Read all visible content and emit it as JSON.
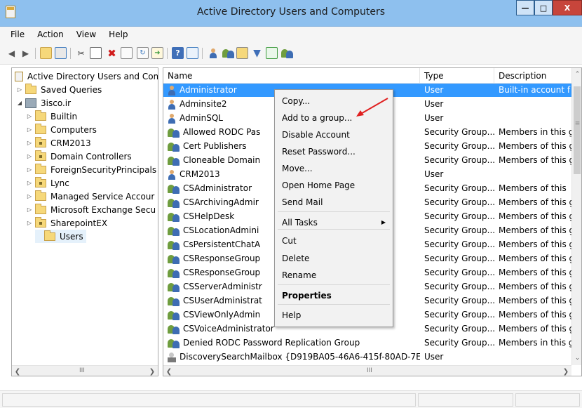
{
  "window": {
    "title": "Active Directory Users and Computers",
    "controls": {
      "minimize": "—",
      "maximize": "□",
      "close": "X"
    }
  },
  "menubar": [
    "File",
    "Action",
    "View",
    "Help"
  ],
  "toolbar_icons": [
    "back-arrow-icon",
    "forward-arrow-icon",
    "up-folder-icon",
    "show-console-tree-icon",
    "cut-icon",
    "copy-icon",
    "delete-icon",
    "properties-icon",
    "refresh-icon",
    "export-list-icon",
    "help-icon",
    "action-pane-icon",
    "new-user-icon",
    "new-group-icon",
    "new-ou-icon",
    "filter-icon",
    "find-icon",
    "add-to-group-icon"
  ],
  "tree": {
    "root": "Active Directory Users and Com",
    "items": [
      {
        "label": "Saved Queries",
        "level": 1,
        "expander": "▷",
        "icon": "folder"
      },
      {
        "label": "3isco.ir",
        "level": 1,
        "expander": "◢",
        "icon": "domain"
      },
      {
        "label": "Builtin",
        "level": 2,
        "expander": "▷",
        "icon": "folder"
      },
      {
        "label": "Computers",
        "level": 2,
        "expander": "▷",
        "icon": "folder"
      },
      {
        "label": "CRM2013",
        "level": 2,
        "expander": "▷",
        "icon": "ou"
      },
      {
        "label": "Domain Controllers",
        "level": 2,
        "expander": "▷",
        "icon": "ou"
      },
      {
        "label": "ForeignSecurityPrincipals",
        "level": 2,
        "expander": "▷",
        "icon": "folder"
      },
      {
        "label": "Lync",
        "level": 2,
        "expander": "▷",
        "icon": "ou"
      },
      {
        "label": "Managed Service Accour",
        "level": 2,
        "expander": "▷",
        "icon": "folder"
      },
      {
        "label": "Microsoft Exchange Secu",
        "level": 2,
        "expander": "▷",
        "icon": "folder"
      },
      {
        "label": "SharepointEX",
        "level": 2,
        "expander": "▷",
        "icon": "ou"
      },
      {
        "label": "Users",
        "level": 2,
        "expander": "",
        "icon": "folder",
        "selected": true
      }
    ],
    "scroll_grip": "III"
  },
  "list": {
    "columns": [
      "Name",
      "Type",
      "Description"
    ],
    "rows": [
      {
        "name": "Administrator",
        "type": "User",
        "desc": "Built-in account f",
        "icon": "user",
        "selected": true
      },
      {
        "name": "Adminsite2",
        "type": "User",
        "desc": "",
        "icon": "user"
      },
      {
        "name": "AdminSQL",
        "type": "User",
        "desc": "",
        "icon": "user"
      },
      {
        "name": "Allowed RODC Pas",
        "type": "Security Group...",
        "desc": "Members in this g",
        "icon": "group"
      },
      {
        "name": "Cert Publishers",
        "type": "Security Group...",
        "desc": "Members of this g",
        "icon": "group"
      },
      {
        "name": "Cloneable Domain",
        "type": "Security Group...",
        "desc": "Members of this g",
        "icon": "group"
      },
      {
        "name": "CRM2013",
        "type": "User",
        "desc": "",
        "icon": "user"
      },
      {
        "name": "CSAdministrator",
        "type": "Security Group...",
        "desc": "Members of this",
        "icon": "group"
      },
      {
        "name": "CSArchivingAdmir",
        "type": "Security Group...",
        "desc": "Members of this g",
        "icon": "group"
      },
      {
        "name": "CSHelpDesk",
        "type": "Security Group...",
        "desc": "Members of this g",
        "icon": "group"
      },
      {
        "name": "CSLocationAdmini",
        "type": "Security Group...",
        "desc": "Members of this g",
        "icon": "group"
      },
      {
        "name": "CsPersistentChatA",
        "type": "Security Group...",
        "desc": "Members of this g",
        "icon": "group"
      },
      {
        "name": "CSResponseGroup",
        "type": "Security Group...",
        "desc": "Members of this g",
        "icon": "group"
      },
      {
        "name": "CSResponseGroup",
        "type": "Security Group...",
        "desc": "Members of this g",
        "icon": "group"
      },
      {
        "name": "CSServerAdministr",
        "type": "Security Group...",
        "desc": "Members of this g",
        "icon": "group"
      },
      {
        "name": "CSUserAdministrat",
        "type": "Security Group...",
        "desc": "Members of this g",
        "icon": "group"
      },
      {
        "name": "CSViewOnlyAdmin",
        "type": "Security Group...",
        "desc": "Members of this g",
        "icon": "group"
      },
      {
        "name": "CSVoiceAdministrator",
        "type": "Security Group...",
        "desc": "Members of this g",
        "icon": "group"
      },
      {
        "name": "Denied RODC Password Replication Group",
        "type": "Security Group...",
        "desc": "Members in this g",
        "icon": "group"
      },
      {
        "name": "DiscoverySearchMailbox {D919BA05-46A6-415f-80AD-7E...",
        "type": "User",
        "desc": "",
        "icon": "mailbox"
      }
    ],
    "scroll_grip": "III"
  },
  "context_menu": {
    "items": [
      {
        "label": "Copy...",
        "bold": false
      },
      {
        "label": "Add to a group...",
        "bold": false
      },
      {
        "label": "Disable Account",
        "bold": false
      },
      {
        "label": "Reset Password...",
        "bold": false
      },
      {
        "label": "Move...",
        "bold": false
      },
      {
        "label": "Open Home Page",
        "bold": false
      },
      {
        "label": "Send Mail",
        "bold": false
      },
      {
        "label": "All Tasks",
        "bold": false,
        "submenu": "▶"
      },
      {
        "label": "Cut",
        "bold": false
      },
      {
        "label": "Delete",
        "bold": false
      },
      {
        "label": "Rename",
        "bold": false
      },
      {
        "label": "Properties",
        "bold": true
      },
      {
        "label": "Help",
        "bold": false
      }
    ]
  },
  "colors": {
    "titlebar": "#8ec0ee",
    "selection": "#3399ff",
    "annotation_arrow": "#e02020"
  }
}
